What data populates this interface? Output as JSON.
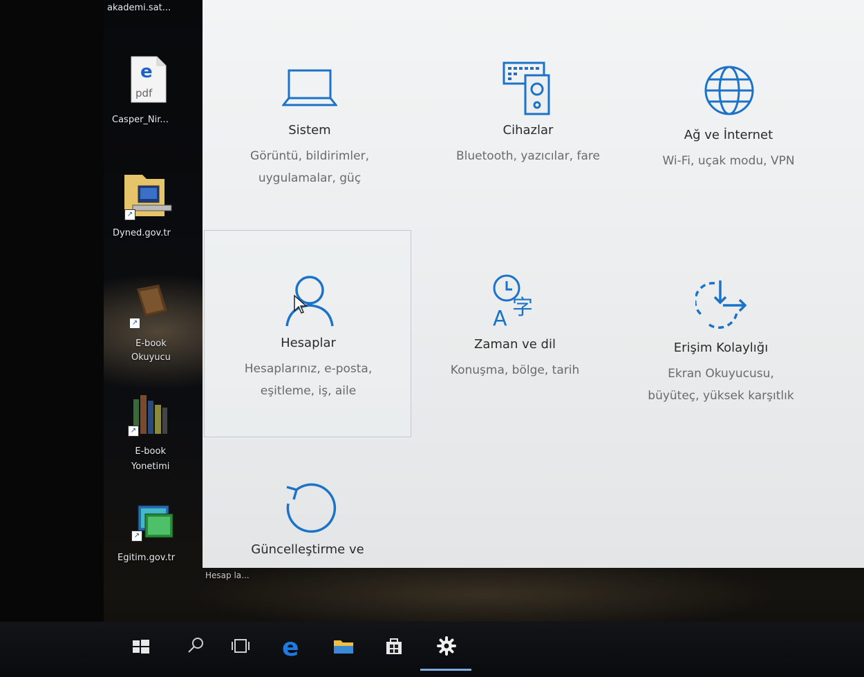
{
  "desktop": {
    "top_label": "akademi.sat...",
    "icons": [
      {
        "label": "Casper_Nir...",
        "icon": "edge-pdf-icon",
        "badge": "pdf"
      },
      {
        "label": "Dyned.gov.tr",
        "icon": "computer-folder-icon"
      },
      {
        "label": "E-book\nOkuyucu",
        "icon": "ebook-reader-icon"
      },
      {
        "label": "E-book\nYonetimi",
        "icon": "books-icon"
      },
      {
        "label": "Egitim.gov.tr",
        "icon": "network-screens-icon"
      }
    ],
    "hidden_label": "Hesap la..."
  },
  "settings": {
    "accent_color": "#1a73c8",
    "tiles": [
      {
        "title": "Sistem",
        "desc": [
          "Görüntü, bildirimler,",
          "uygulamalar, güç"
        ],
        "icon": "laptop-icon"
      },
      {
        "title": "Cihazlar",
        "desc": [
          "Bluetooth, yazıcılar, fare"
        ],
        "icon": "keyboard-speaker-icon"
      },
      {
        "title": "Ağ ve İnternet",
        "desc": [
          "Wi-Fi, uçak modu, VPN"
        ],
        "icon": "globe-icon"
      },
      {
        "title": "Hesaplar",
        "desc": [
          "Hesaplarınız, e-posta,",
          "eşitleme, iş, aile"
        ],
        "icon": "person-icon",
        "selected": true
      },
      {
        "title": "Zaman ve dil",
        "desc": [
          "Konuşma, bölge, tarih"
        ],
        "icon": "time-language-icon"
      },
      {
        "title": "Erişim Kolaylığı",
        "desc": [
          "Ekran Okuyucusu,",
          "büyüteç, yüksek karşıtlık"
        ],
        "icon": "ease-of-access-icon"
      },
      {
        "title": "Güncelleştirme ve",
        "desc": [],
        "icon": "update-refresh-icon"
      }
    ]
  },
  "taskbar": {
    "items": [
      "windows-start-icon",
      "search-icon",
      "task-view-icon",
      "edge-browser-icon",
      "file-explorer-icon",
      "store-icon",
      "settings-gear-icon"
    ],
    "active": "settings-gear-icon"
  }
}
